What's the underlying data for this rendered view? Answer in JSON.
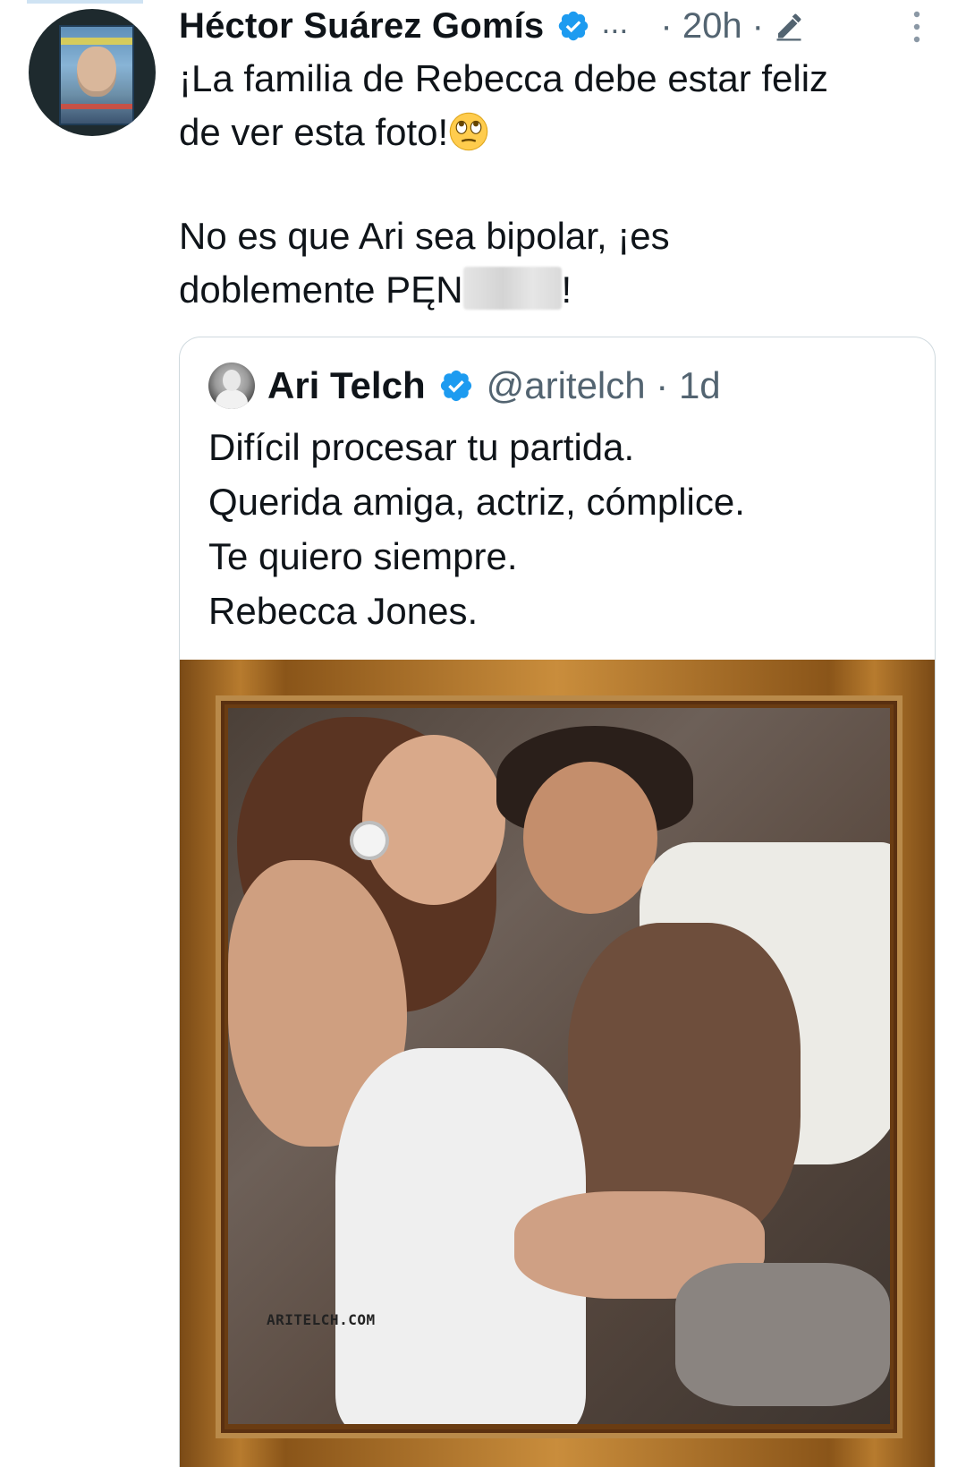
{
  "tweet": {
    "author_name": "Héctor Suárez Gomís",
    "ellipsis": "...",
    "time": "· 20h ·",
    "line1": "¡La familia de Rebecca debe estar feliz",
    "line2": "de ver esta foto!",
    "line3": "No es que Ari sea bipolar, ¡es",
    "line4_prefix": "doblemente PĘN",
    "line4_suffix": "!"
  },
  "quoted": {
    "author_name": "Ari Telch",
    "handle_time": "@aritelch · 1d",
    "lines": [
      "Difícil procesar tu partida.",
      "Querida amiga, actriz, cómplice.",
      "Te quiero siempre.",
      "Rebecca Jones."
    ],
    "watermark": "ARITELCH.COM"
  },
  "colors": {
    "verified": "#1d9bf0",
    "secondary_text": "#536471",
    "border": "#cfd9de"
  },
  "icons": {
    "verified": "verified-badge-icon",
    "edit": "edit-pencil-icon",
    "more": "more-vertical-icon",
    "emoji": "rolling-eyes-emoji-icon"
  }
}
